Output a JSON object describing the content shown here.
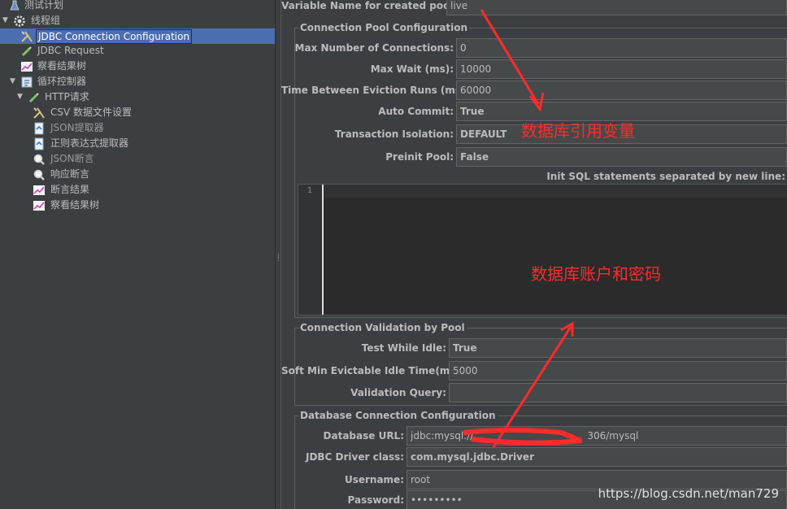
{
  "tree": {
    "items": [
      {
        "label": "测试计划",
        "icon": "flask-icon"
      },
      {
        "label": "线程组",
        "icon": "gear-icon"
      },
      {
        "label": "JDBC Connection Configuration",
        "icon": "wrench-icon"
      },
      {
        "label": "JDBC Request",
        "icon": "pipette-icon"
      },
      {
        "label": "察看结果树",
        "icon": "graph-icon"
      },
      {
        "label": "循环控制器",
        "icon": "loop-icon"
      },
      {
        "label": "HTTP请求",
        "icon": "pipette-icon"
      },
      {
        "label": "CSV 数据文件设置",
        "icon": "wrench-icon"
      },
      {
        "label": "JSON提取器",
        "icon": "extractor-icon"
      },
      {
        "label": "正则表达式提取器",
        "icon": "extractor-icon"
      },
      {
        "label": "JSON断言",
        "icon": "magnifier-icon"
      },
      {
        "label": "响应断言",
        "icon": "magnifier-icon"
      },
      {
        "label": "断言结果",
        "icon": "graph-icon"
      },
      {
        "label": "察看结果树",
        "icon": "graph-icon"
      }
    ]
  },
  "variable_name": {
    "label": "Variable Name for created pool:",
    "value": "live"
  },
  "pool_config": {
    "title": "Connection Pool Configuration",
    "fields": [
      {
        "label": "Max Number of Connections:",
        "value": "0"
      },
      {
        "label": "Max Wait (ms):",
        "value": "10000"
      },
      {
        "label": "Time Between Eviction Runs (ms):",
        "value": "60000"
      },
      {
        "label": "Auto Commit:",
        "value": "True"
      },
      {
        "label": "Transaction Isolation:",
        "value": "DEFAULT"
      },
      {
        "label": "Preinit Pool:",
        "value": "False"
      }
    ],
    "init_sql_label": "Init SQL statements separated by new line:",
    "line_number": "1"
  },
  "validation": {
    "title": "Connection Validation by Pool",
    "fields": [
      {
        "label": "Test While Idle:",
        "value": "True"
      },
      {
        "label": "Soft Min Evictable Idle Time(ms):",
        "value": "5000"
      },
      {
        "label": "Validation Query:",
        "value": ""
      }
    ]
  },
  "db_config": {
    "title": "Database Connection Configuration",
    "fields": [
      {
        "label": "Database URL:",
        "value": "jdbc:mysql://"
      },
      {
        "label": "JDBC Driver class:",
        "value": "com.mysql.jdbc.Driver"
      },
      {
        "label": "Username:",
        "value": "root"
      },
      {
        "label": "Password:",
        "value": "•••••••••"
      }
    ],
    "url_tail": "306/mysql"
  },
  "annotations": {
    "var_ref": "数据库引用变量",
    "account": "数据库账户和密码"
  },
  "watermark": "https://blog.csdn.net/man729",
  "colors": {
    "background": "#3c3f41",
    "selection": "#4b6eaf",
    "annotation": "#ff2a2a"
  }
}
